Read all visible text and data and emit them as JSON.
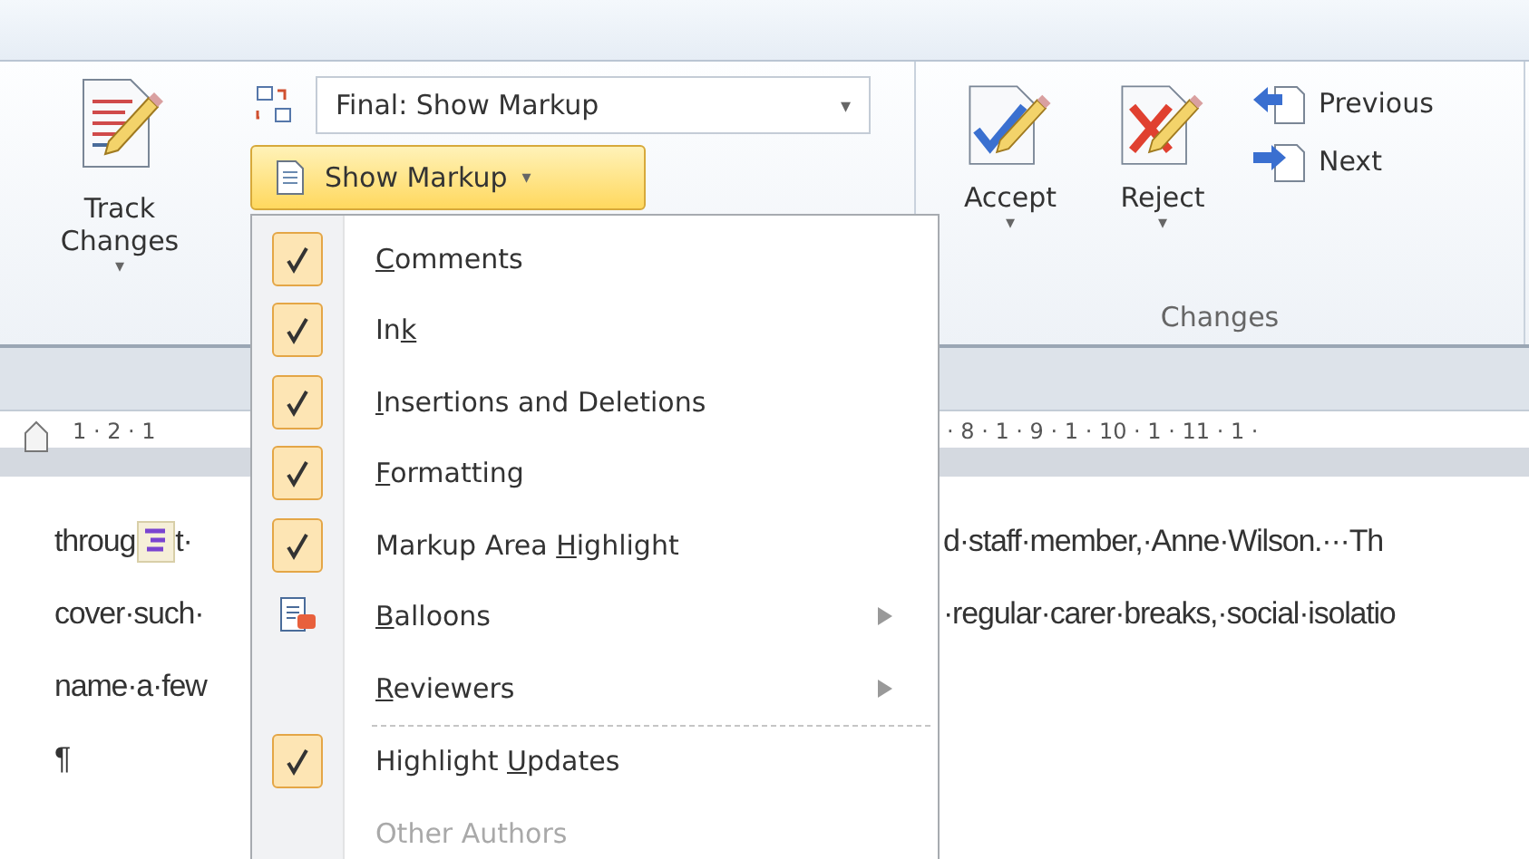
{
  "ribbon": {
    "track_changes": {
      "label_line_1": "Track",
      "label_line_2": "Changes",
      "caret": "▾"
    },
    "display_combo": {
      "value": "Final: Show Markup",
      "caret": "▾"
    },
    "show_markup_button": {
      "label": "Show Markup",
      "caret": "▾",
      "selected": true
    },
    "changes_group": {
      "title": "Changes",
      "accept": {
        "label": "Accept",
        "caret": "▾"
      },
      "reject": {
        "label": "Reject",
        "caret": "▾"
      },
      "previous": {
        "label": "Previous"
      },
      "next": {
        "label": "Next"
      }
    }
  },
  "ruler": {
    "left_numbers": "1 · 2 · 1",
    "right_numbers": "· 8 · 1 · 9 · 1 · 10 · 1 · 11 · 1 ·"
  },
  "document": {
    "lines": [
      {
        "left": "throug",
        "comment_marker": true,
        "left_after_icon": "t·",
        "right": "d·staff·member,·Anne·Wilson.···Th"
      },
      {
        "left": "cover·such·",
        "right": "·regular·carer·breaks,·social·isolatio"
      },
      {
        "left": "name·a·few"
      },
      {
        "left": "¶"
      }
    ]
  },
  "show_markup_menu": {
    "items": [
      {
        "kind": "check",
        "access_key": "C",
        "label_after": "omments",
        "checked": true,
        "disabled": false,
        "submenu": false,
        "separator_before": false
      },
      {
        "kind": "check",
        "label_before": "In",
        "access_key": "k",
        "checked": true,
        "disabled": false,
        "submenu": false,
        "separator_before": false
      },
      {
        "kind": "check",
        "access_key": "I",
        "label_after": "nsertions and Deletions",
        "checked": true,
        "disabled": false,
        "submenu": false,
        "separator_before": false
      },
      {
        "kind": "check",
        "access_key": "F",
        "label_after": "ormatting",
        "checked": true,
        "disabled": false,
        "submenu": false,
        "separator_before": false
      },
      {
        "kind": "check",
        "label_before": "Markup Area ",
        "access_key": "H",
        "label_after": "ighlight",
        "checked": true,
        "disabled": false,
        "submenu": false,
        "separator_before": false
      },
      {
        "kind": "icon",
        "access_key": "B",
        "label_after": "alloons",
        "disabled": false,
        "submenu": true,
        "separator_before": false
      },
      {
        "kind": "plain",
        "access_key": "R",
        "label_after": "eviewers",
        "disabled": false,
        "submenu": true,
        "separator_before": false
      },
      {
        "kind": "check",
        "label_before": "Highlight ",
        "access_key": "U",
        "label_after": "pdates",
        "checked": true,
        "disabled": false,
        "submenu": false,
        "separator_before": true
      },
      {
        "kind": "plain",
        "label_before": "Other Authors",
        "disabled": true,
        "submenu": false,
        "separator_before": false
      }
    ]
  }
}
